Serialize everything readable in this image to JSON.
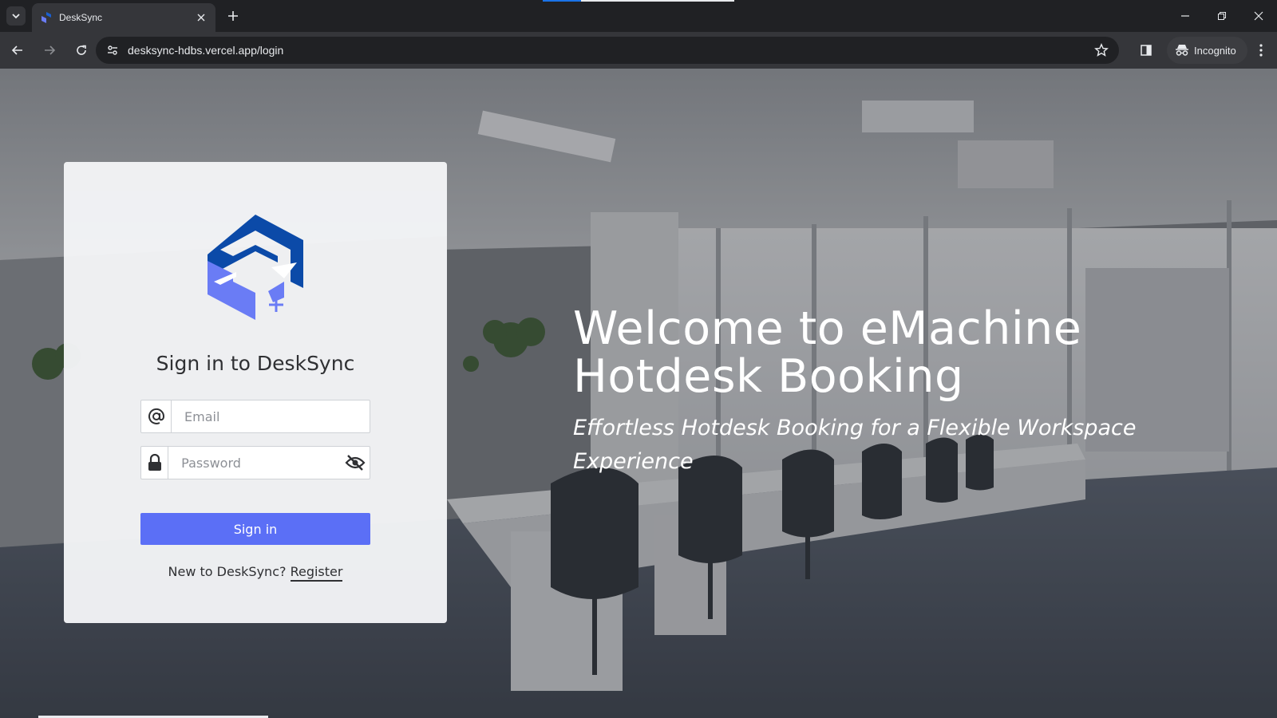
{
  "browser": {
    "tab_title": "DeskSync",
    "url": "desksync-hdbs.vercel.app/login",
    "incognito_label": "Incognito"
  },
  "login": {
    "title": "Sign in to DeskSync",
    "email_placeholder": "Email",
    "password_placeholder": "Password",
    "signin_label": "Sign in",
    "register_prompt": "New to DeskSync?",
    "register_link": "Register"
  },
  "hero": {
    "title_line1": "Welcome to eMachine",
    "title_line2": "Hotdesk Booking",
    "subtitle": "Effortless Hotdesk Booking for a Flexible Workspace Experience"
  },
  "colors": {
    "primary_button": "#5b6ff6",
    "logo_dark_blue": "#0b4aa8",
    "logo_light_blue": "#6a7cf5",
    "chrome_dark": "#202124",
    "chrome_toolbar": "#35363a"
  },
  "icons": {
    "tab_search": "chevron-down-icon",
    "favicon": "desksync-logo-icon",
    "tab_close": "close-icon",
    "new_tab": "plus-icon",
    "back": "arrow-left-icon",
    "forward": "arrow-right-icon",
    "reload": "reload-icon",
    "site_info": "tune-icon",
    "bookmark": "star-icon",
    "side_panel": "side-panel-icon",
    "incognito": "incognito-icon",
    "menu": "kebab-icon",
    "email_field": "at-sign-icon",
    "password_field": "lock-icon",
    "toggle_password": "eye-off-icon"
  }
}
